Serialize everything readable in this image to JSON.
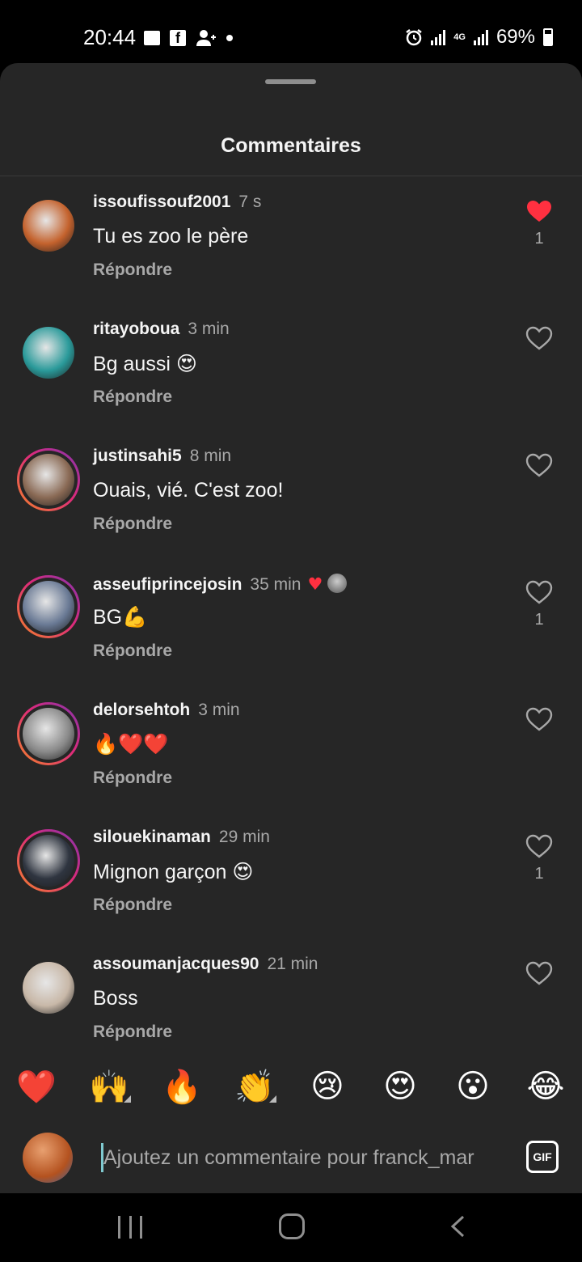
{
  "status_bar": {
    "time": "20:44",
    "network": "4G",
    "battery": "69%",
    "icons": [
      "image-icon",
      "facebook-icon",
      "add-person-icon",
      "notification-dot",
      "alarm-icon",
      "signal-icon",
      "signal-icon",
      "battery-icon"
    ]
  },
  "header": {
    "title": "Commentaires"
  },
  "comments": [
    {
      "username": "issoufissouf2001",
      "time": "7 s",
      "text": "Tu es zoo le père",
      "reply_label": "Répondre",
      "liked": true,
      "like_count": "1",
      "avatar_ring": false,
      "avatar_color": "#c4622d"
    },
    {
      "username": "ritayoboua",
      "time": "3 min",
      "text": "Bg aussi 😍",
      "reply_label": "Répondre",
      "liked": false,
      "like_count": "",
      "avatar_ring": false,
      "avatar_color": "#2a9a9a"
    },
    {
      "username": "justinsahi5",
      "time": "8 min",
      "text": "Ouais, vié. C'est zoo!",
      "reply_label": "Répondre",
      "liked": false,
      "like_count": "",
      "avatar_ring": true,
      "avatar_color": "#8a6a55"
    },
    {
      "username": "asseufiprincejosin",
      "time": "35 min",
      "text": "BG💪",
      "reply_label": "Répondre",
      "liked": false,
      "like_count": "1",
      "avatar_ring": true,
      "avatar_color": "#6a7a95",
      "creator_liked": true
    },
    {
      "username": "delorsehtoh",
      "time": "3 min",
      "text": "🔥❤️❤️",
      "reply_label": "Répondre",
      "liked": false,
      "like_count": "",
      "avatar_ring": true,
      "avatar_color": "#8a8a8a"
    },
    {
      "username": "silouekinaman",
      "time": "29 min",
      "text": "Mignon garçon 😍",
      "reply_label": "Répondre",
      "liked": false,
      "like_count": "1",
      "avatar_ring": true,
      "avatar_color": "#2f3540"
    },
    {
      "username": "assoumanjacques90",
      "time": "21 min",
      "text": "Boss",
      "reply_label": "Répondre",
      "liked": false,
      "like_count": "",
      "avatar_ring": false,
      "avatar_color": "#c8b8a8"
    }
  ],
  "reactions": [
    {
      "emoji": "❤️",
      "name": "heart",
      "has_variants": false
    },
    {
      "emoji": "🙌",
      "name": "raising-hands",
      "has_variants": true
    },
    {
      "emoji": "🔥",
      "name": "fire",
      "has_variants": false
    },
    {
      "emoji": "👏",
      "name": "clapping-hands",
      "has_variants": true
    },
    {
      "emoji": "😢",
      "name": "crying-face",
      "has_variants": false
    },
    {
      "emoji": "😍",
      "name": "heart-eyes",
      "has_variants": false
    },
    {
      "emoji": "😮",
      "name": "surprised-face",
      "has_variants": false
    },
    {
      "emoji": "😂",
      "name": "tears-of-joy",
      "has_variants": false
    }
  ],
  "input": {
    "placeholder": "Ajoutez un commentaire pour franck_mar",
    "gif_label": "GIF"
  },
  "colors": {
    "sheet_bg": "#262626",
    "like_red": "#ff3040",
    "muted_text": "#a8a8a8",
    "caret": "#7fc9cf"
  }
}
